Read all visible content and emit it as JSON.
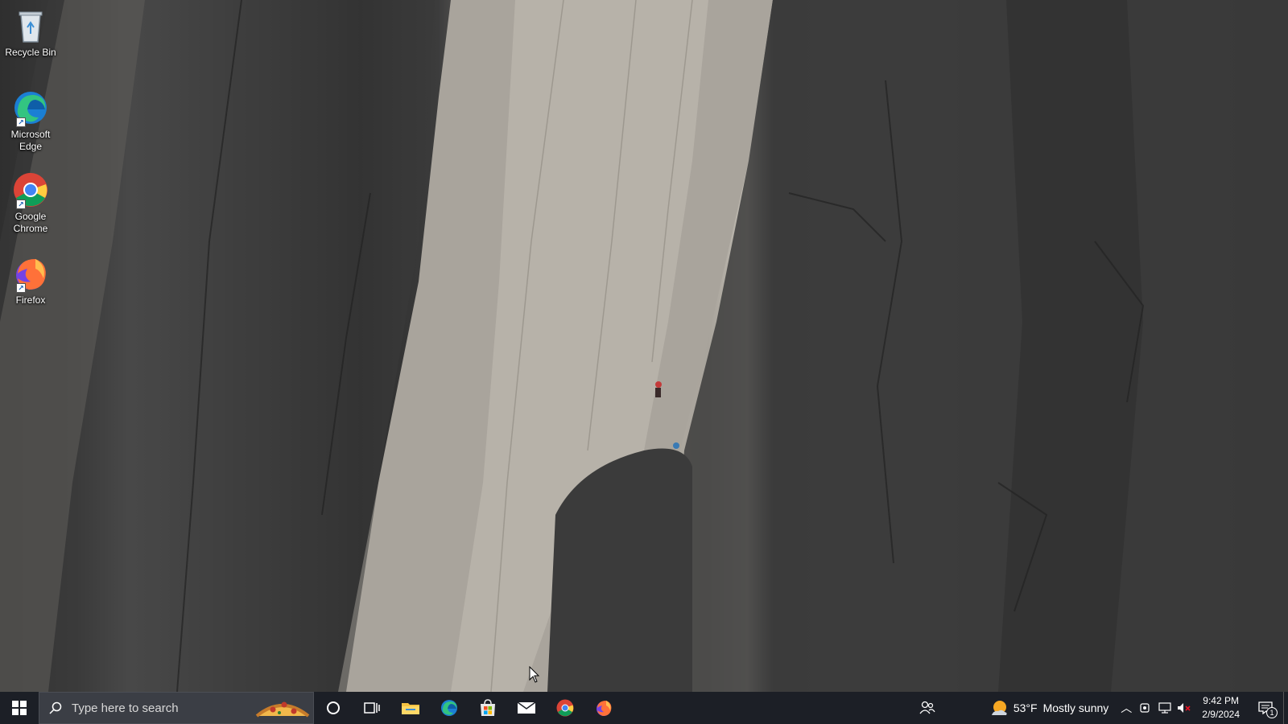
{
  "desktop": {
    "icons": [
      {
        "label": "Recycle Bin",
        "icon": "recycle-bin-icon"
      },
      {
        "label": "Microsoft Edge",
        "icon": "edge-icon"
      },
      {
        "label": "Google Chrome",
        "icon": "chrome-icon"
      },
      {
        "label": "Firefox",
        "icon": "firefox-icon"
      }
    ]
  },
  "taskbar": {
    "search_placeholder": "Type here to search",
    "pinned_apps": [
      "cortana-icon",
      "task-view-icon",
      "file-explorer-icon",
      "edge-icon",
      "microsoft-store-icon",
      "mail-icon",
      "chrome-icon",
      "firefox-icon"
    ],
    "weather": {
      "temperature": "53°F",
      "condition": "Mostly sunny"
    },
    "clock": {
      "time": "9:42 PM",
      "date": "2/9/2024"
    },
    "notification_count": "1"
  },
  "colors": {
    "taskbar_bg": "#1c1f26",
    "search_bg": "#3b3e45",
    "running_indicator": "#9dbdf2"
  }
}
